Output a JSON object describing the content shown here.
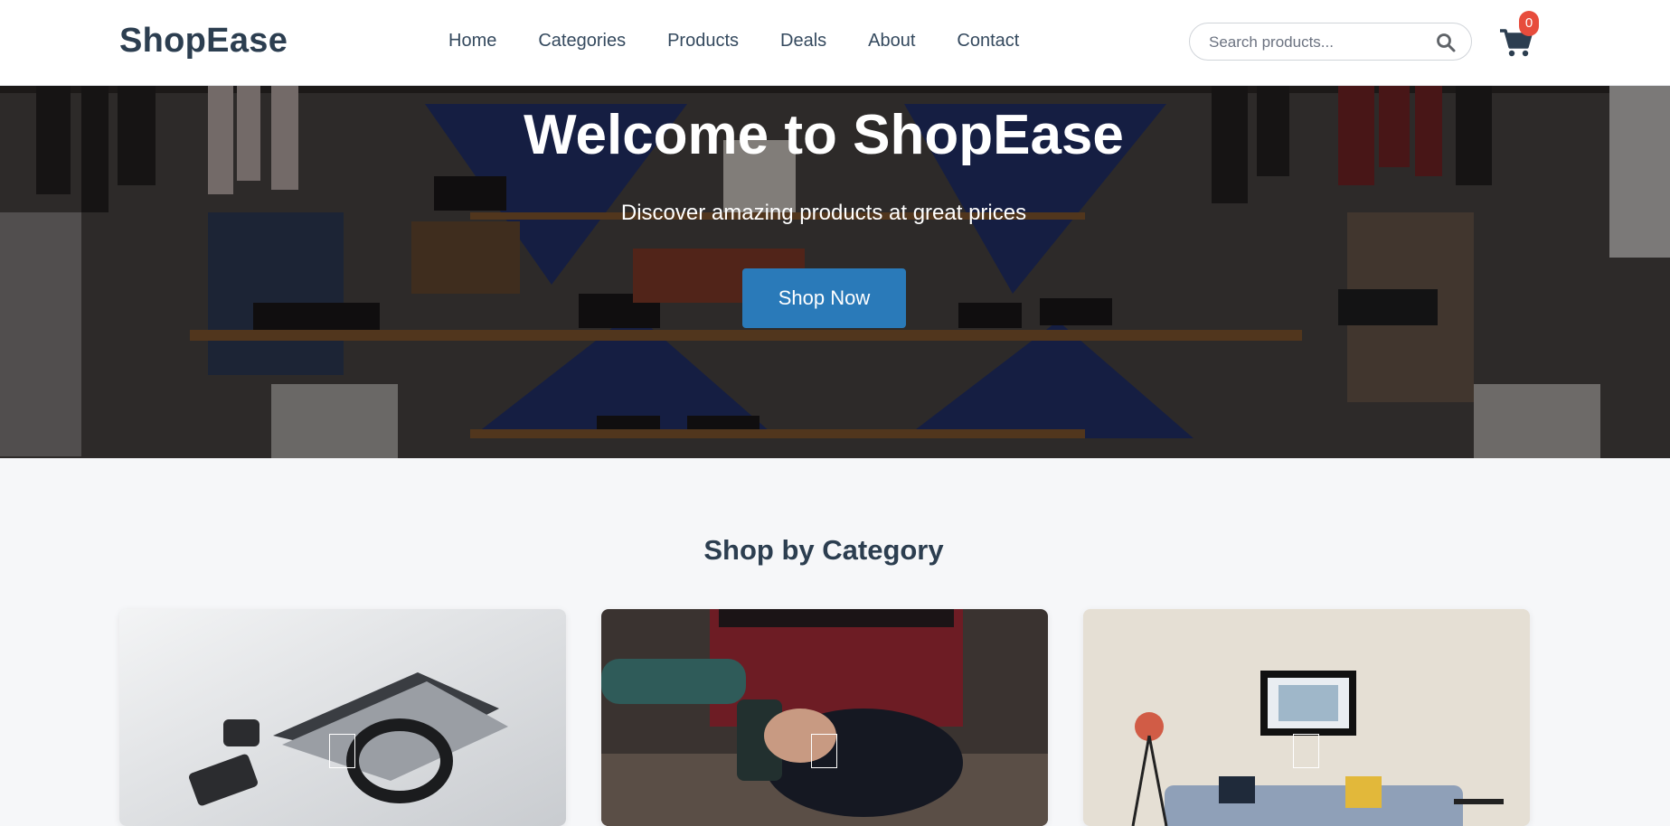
{
  "header": {
    "logo": "ShopEase",
    "nav": [
      "Home",
      "Categories",
      "Products",
      "Deals",
      "About",
      "Contact"
    ],
    "search_placeholder": "Search products...",
    "search_icon": "search-icon",
    "cart_icon": "cart-icon",
    "cart_count": "0"
  },
  "hero": {
    "title": "Welcome to ShopEase",
    "subtitle": "Discover amazing products at great prices",
    "cta": "Shop Now"
  },
  "categories": {
    "title": "Shop by Category",
    "cards": [
      {
        "image": "electronics-photo"
      },
      {
        "image": "outdoor-photo"
      },
      {
        "image": "home-decor-photo"
      }
    ]
  },
  "colors": {
    "primary": "#2a7ab9",
    "heading": "#2c3e50",
    "badge": "#e74c3c"
  }
}
